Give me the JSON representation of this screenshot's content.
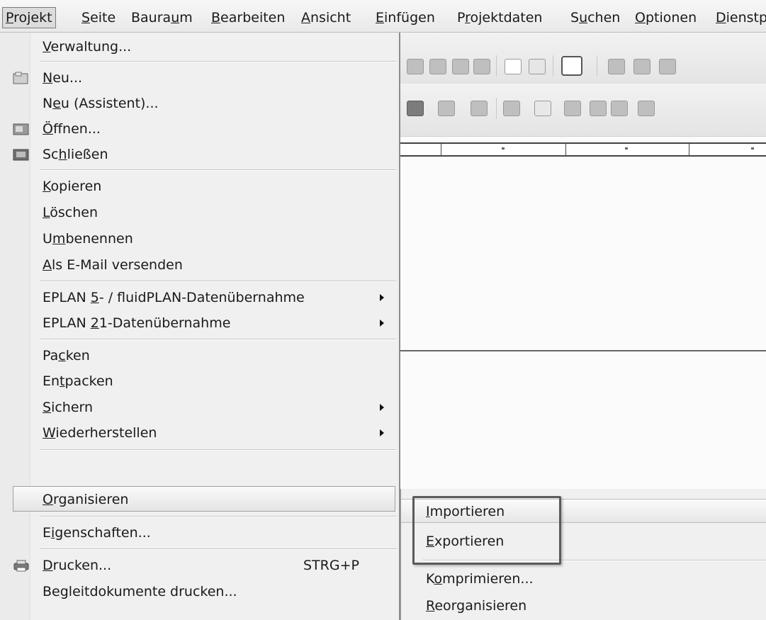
{
  "menubar": {
    "items": [
      {
        "label": "Projekt",
        "ul": 0
      },
      {
        "label": "Seite",
        "ul": 0
      },
      {
        "label": "Bauraum",
        "ul": 5
      },
      {
        "label": "Bearbeiten",
        "ul": 0
      },
      {
        "label": "Ansicht",
        "ul": 0
      },
      {
        "label": "Einfügen",
        "ul": 0
      },
      {
        "label": "Projektdaten",
        "ul": 1
      },
      {
        "label": "Suchen",
        "ul": 1
      },
      {
        "label": "Optionen",
        "ul": 0
      },
      {
        "label": "Dienstp",
        "ul": 0
      }
    ]
  },
  "projekt_menu": {
    "items": [
      {
        "label": "Verwaltung...",
        "ul": 0
      },
      {
        "label": "Neu...",
        "ul": 0,
        "icon": "new-project-icon"
      },
      {
        "label": "Neu (Assistent)...",
        "ul": 1
      },
      {
        "label": "Öffnen...",
        "ul": 0,
        "icon": "open-project-icon"
      },
      {
        "label": "Schließen",
        "ul": 2,
        "icon": "close-project-icon"
      },
      {
        "label": "Kopieren",
        "ul": 0
      },
      {
        "label": "Löschen",
        "ul": 0
      },
      {
        "label": "Umbenennen",
        "ul": 1
      },
      {
        "label": "Als E-Mail versenden",
        "ul": 0
      },
      {
        "label": "EPLAN 5- / fluidPLAN-Datenübernahme",
        "ul": 6,
        "submenu": true
      },
      {
        "label": "EPLAN 21-Datenübernahme",
        "ul": 6,
        "submenu": true
      },
      {
        "label": "Packen",
        "ul": 2
      },
      {
        "label": "Entpacken",
        "ul": 2
      },
      {
        "label": "Sichern",
        "ul": 0,
        "submenu": true
      },
      {
        "label": "Wiederherstellen",
        "ul": 0,
        "submenu": true
      },
      {
        "label": "Organisieren",
        "ul": 0,
        "highlighted": true
      },
      {
        "label": "Eigenschaften...",
        "ul": 1
      },
      {
        "label": "Drucken...",
        "ul": 0,
        "shortcut": "STRG+P",
        "icon": "printer-icon"
      },
      {
        "label": "Begleitdokumente drucken...",
        "ul": 2
      }
    ]
  },
  "organisieren_submenu": {
    "items": [
      {
        "label": "Importieren",
        "ul": 0
      },
      {
        "label": "Exportieren",
        "ul": 0
      },
      {
        "label": "Komprimieren...",
        "ul": 1
      },
      {
        "label": "Reorganisieren",
        "ul": 0
      }
    ]
  }
}
